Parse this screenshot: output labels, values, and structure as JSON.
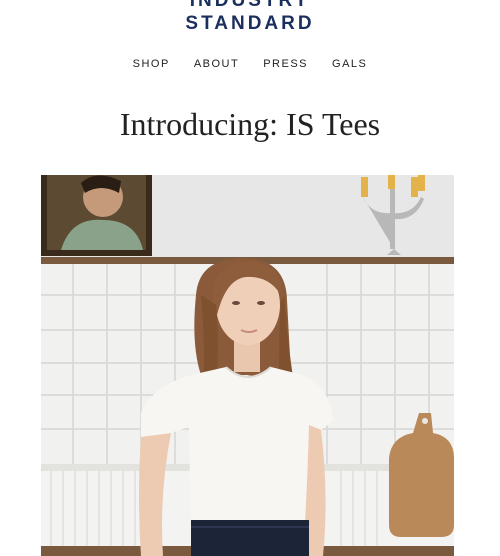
{
  "brand": {
    "line1": "INDUSTRY",
    "line2": "STANDARD"
  },
  "nav": [
    {
      "label": "SHOP"
    },
    {
      "label": "ABOUT"
    },
    {
      "label": "PRESS"
    },
    {
      "label": "GALS"
    }
  ],
  "hero": {
    "headline": "Introducing: IS Tees"
  },
  "colors": {
    "brand": "#1b2f5e",
    "text": "#222222",
    "background": "#ffffff"
  }
}
